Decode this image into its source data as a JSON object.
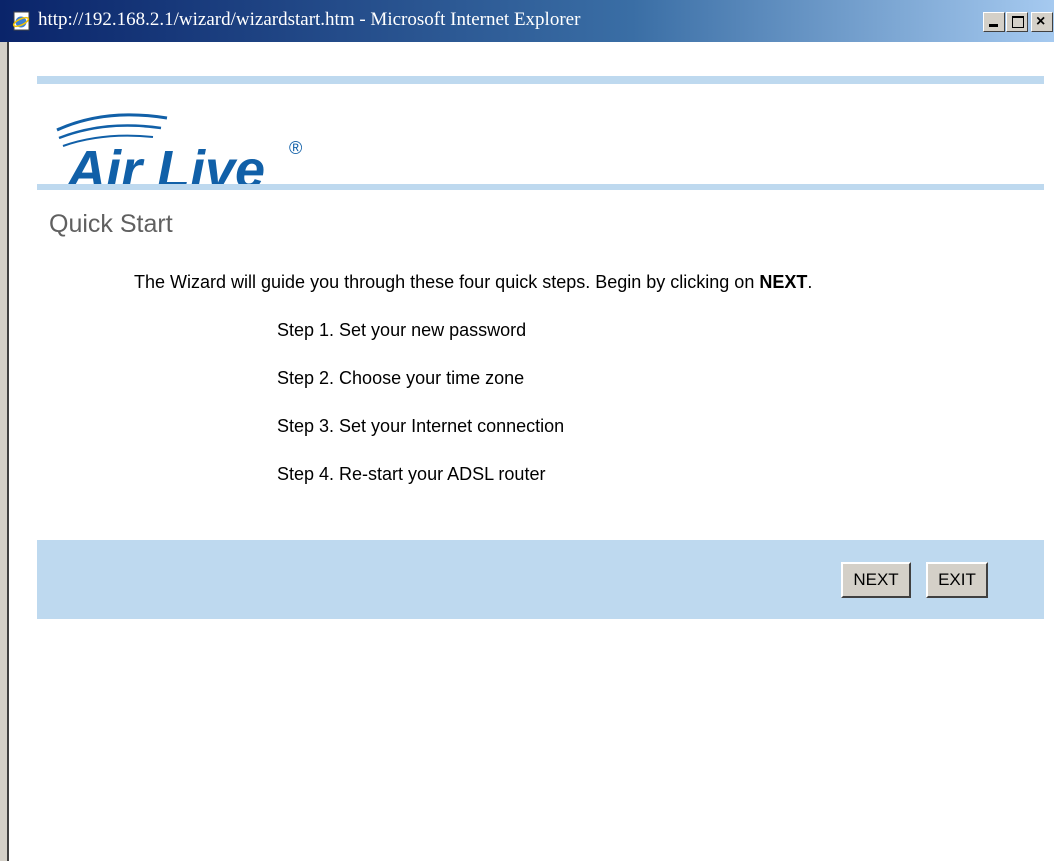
{
  "window": {
    "title": "http://192.168.2.1/wizard/wizardstart.htm - Microsoft Internet Explorer"
  },
  "logo": {
    "text": "Air Live",
    "mark": "®"
  },
  "page": {
    "title": "Quick Start",
    "intro_prefix": "The Wizard will guide you through these four quick steps. Begin by clicking on ",
    "intro_emphasis": "NEXT",
    "intro_suffix": ".",
    "steps": [
      "Step 1. Set your new password",
      "Step 2. Choose your time zone",
      "Step 3. Set your Internet connection",
      "Step 4. Re-start your ADSL router"
    ]
  },
  "buttons": {
    "next": "NEXT",
    "exit": "EXIT"
  },
  "colors": {
    "brand_blue": "#1160a8",
    "band": "#bed9ef"
  },
  "icons": {
    "title": "ie-page-icon",
    "minimize": "minimize-icon",
    "maximize": "maximize-icon",
    "close": "close-icon"
  }
}
